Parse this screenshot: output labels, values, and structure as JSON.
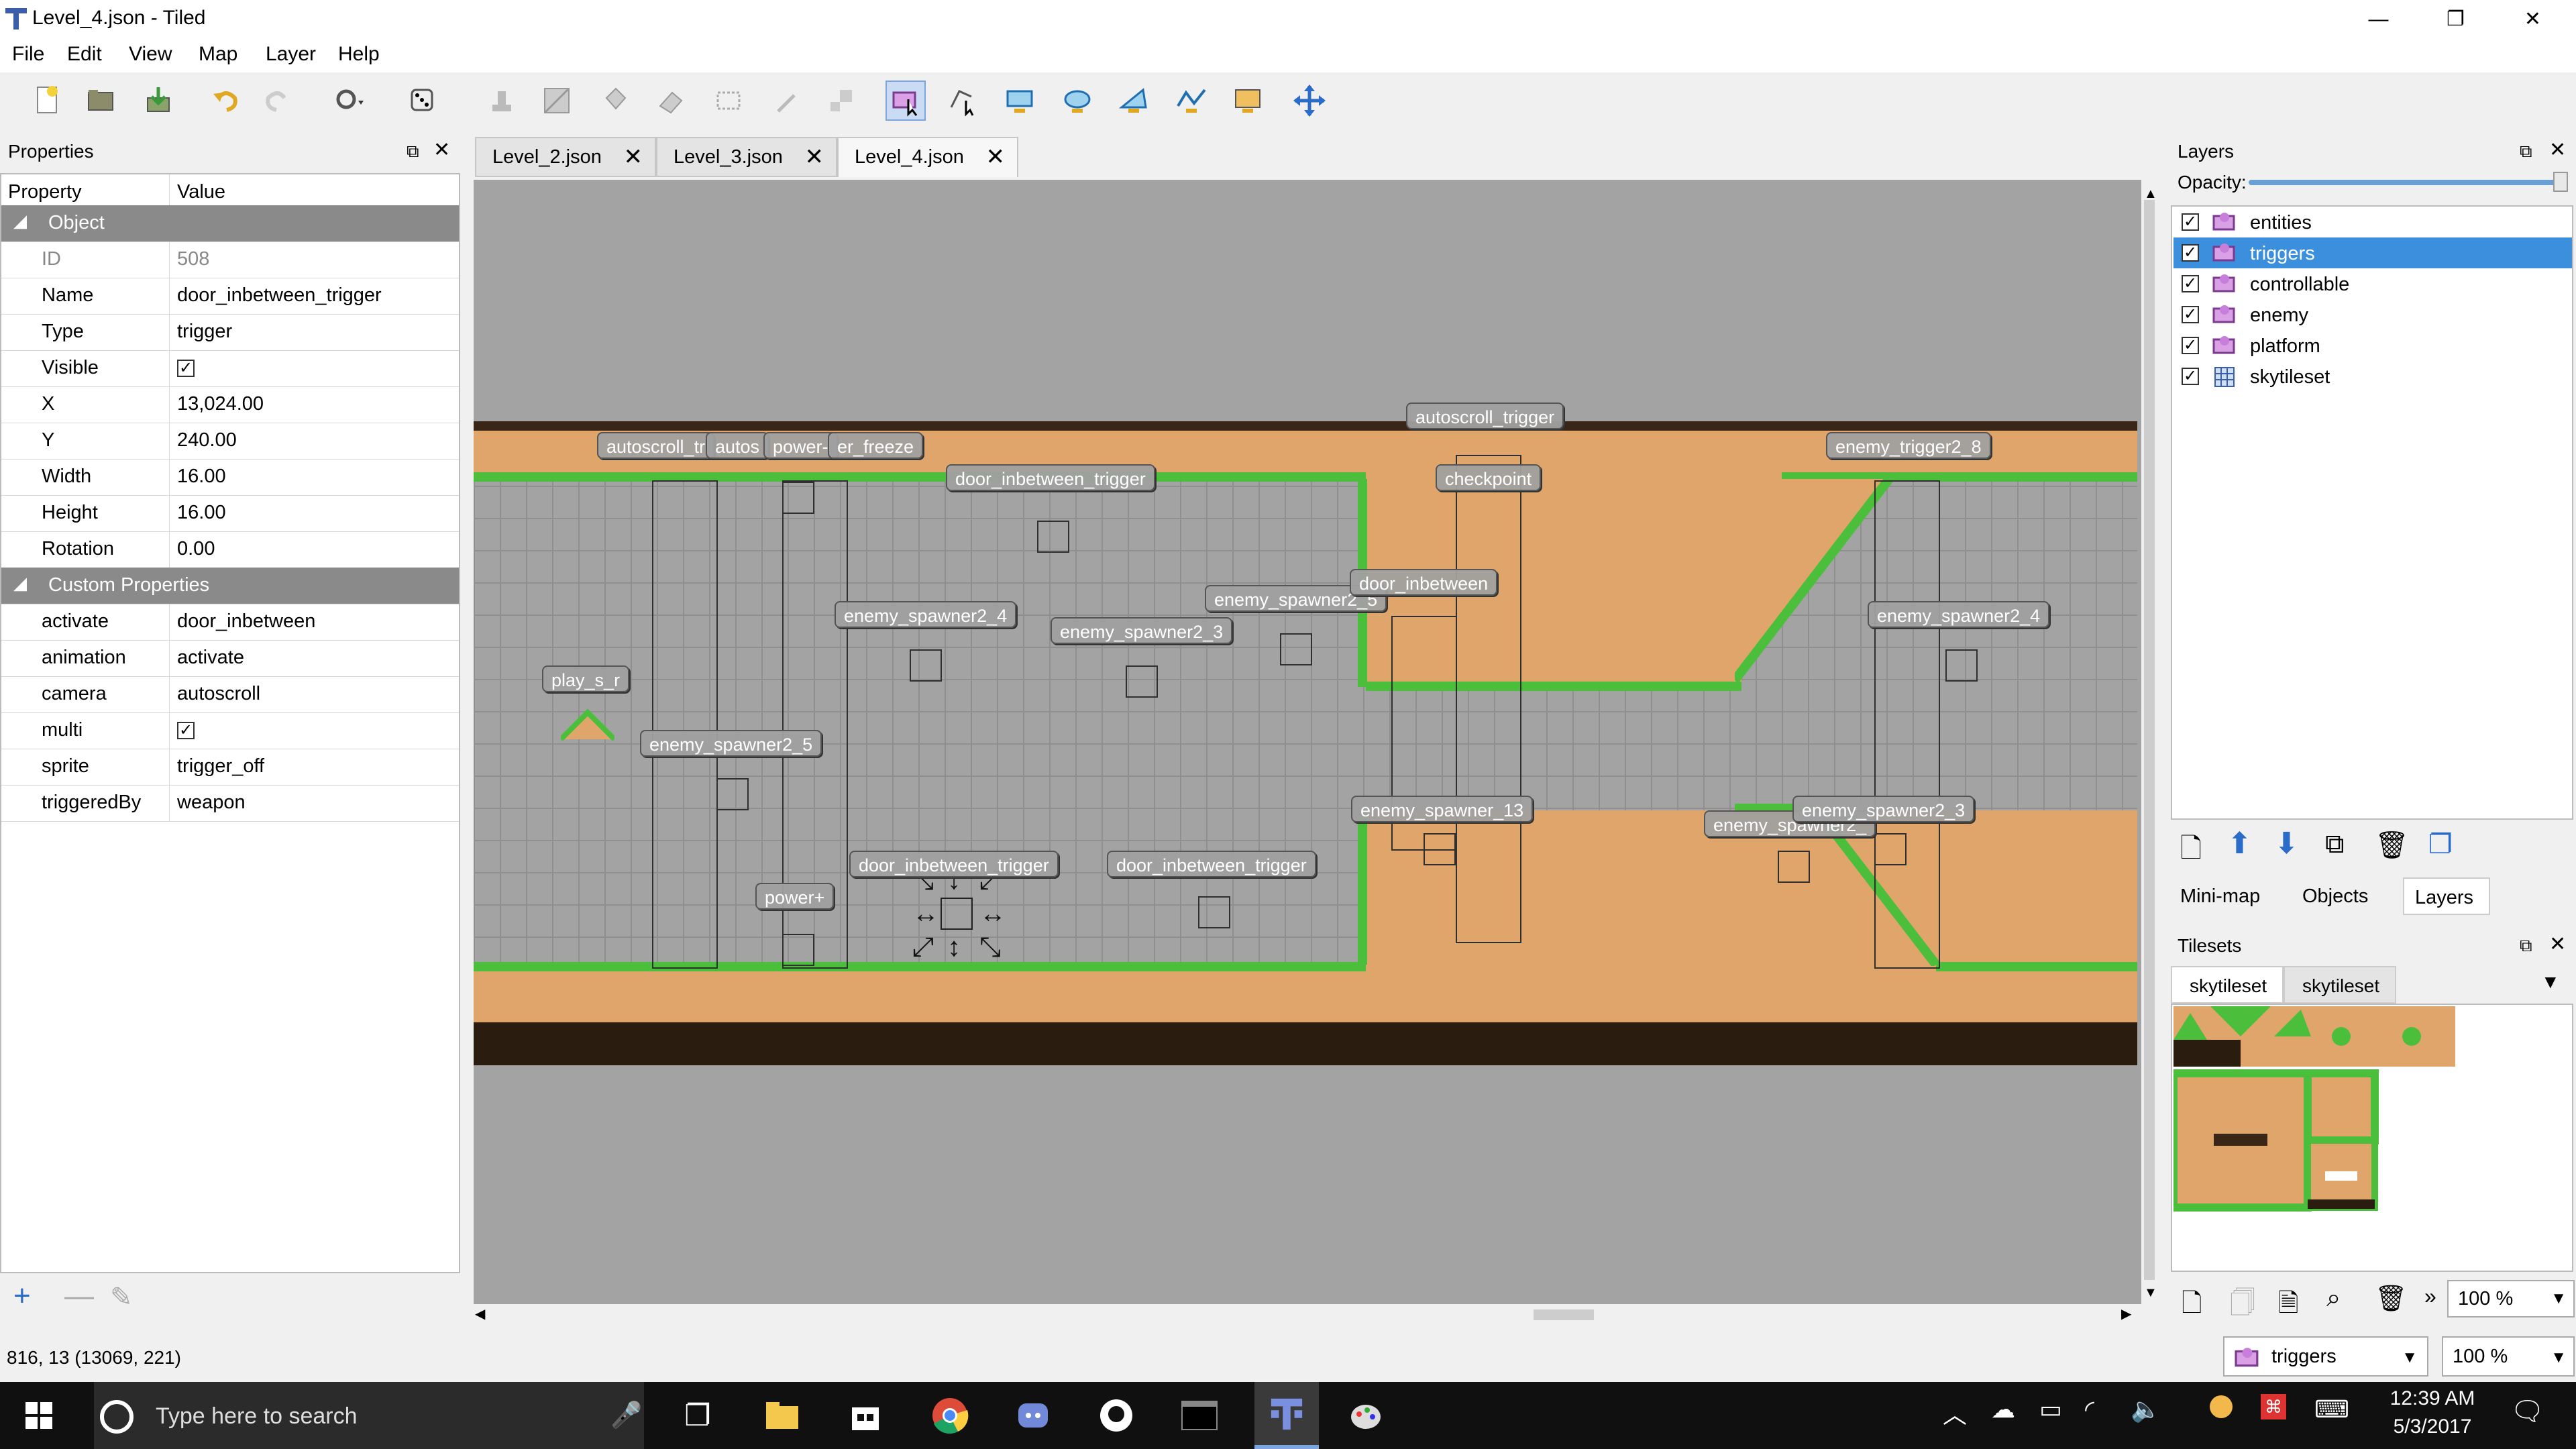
{
  "window": {
    "title": "Level_4.json - Tiled",
    "minimize": "—",
    "restore": "❐",
    "close": "✕"
  },
  "menu": [
    "File",
    "Edit",
    "View",
    "Map",
    "Layer",
    "Help"
  ],
  "properties": {
    "panel_title": "Properties",
    "col_property": "Property",
    "col_value": "Value",
    "object_group": "Object",
    "id_label": "ID",
    "id_value": "508",
    "name_label": "Name",
    "name_value": "door_inbetween_trigger",
    "type_label": "Type",
    "type_value": "trigger",
    "visible_label": "Visible",
    "visible_value": "✓",
    "x_label": "X",
    "x_value": "13,024.00",
    "y_label": "Y",
    "y_value": "240.00",
    "width_label": "Width",
    "width_value": "16.00",
    "height_label": "Height",
    "height_value": "16.00",
    "rotation_label": "Rotation",
    "rotation_value": "0.00",
    "custom_group": "Custom Properties",
    "activate_label": "activate",
    "activate_value": "door_inbetween",
    "animation_label": "animation",
    "animation_value": "activate",
    "camera_label": "camera",
    "camera_value": "autoscroll",
    "multi_label": "multi",
    "multi_value": "✓",
    "sprite_label": "sprite",
    "sprite_value": "trigger_off",
    "triggeredBy_label": "triggeredBy",
    "triggeredBy_value": "weapon"
  },
  "tabs": [
    {
      "label": "Level_2.json"
    },
    {
      "label": "Level_3.json"
    },
    {
      "label": "Level_4.json"
    }
  ],
  "map_labels": {
    "autoscroll_tr": "autoscroll_tr",
    "autos": "autos",
    "power_minus": "power-",
    "er_freeze": "er_freeze",
    "door_inbetween_trigger_1": "door_inbetween_trigger",
    "autoscroll_trigger": "autoscroll_trigger",
    "checkpoint": "checkpoint",
    "enemy_trigger2_8": "enemy_trigger2_8",
    "enemy_spawner2_4a": "enemy_spawner2_4",
    "enemy_spawner2_3a": "enemy_spawner2_3",
    "enemy_spawner2_5b": "enemy_spawner2_5",
    "door_inbetween": "door_inbetween",
    "enemy_spawner2_4b": "enemy_spawner2_4",
    "play_s_r": "play_s_r",
    "enemy_spawner2_5a": "enemy_spawner2_5",
    "enemy_spawner_13": "enemy_spawner_13",
    "enemy_spawner2_x": "enemy_spawner2_",
    "enemy_spawner2_3b": "enemy_spawner2_3",
    "door_inbetween_trigger_2": "door_inbetween_trigger",
    "door_inbetween_trigger_3": "door_inbetween_trigger",
    "power_plus": "power+"
  },
  "layers": {
    "panel_title": "Layers",
    "opacity_label": "Opacity:",
    "opacity": 1.0,
    "items": [
      {
        "name": "entities",
        "checked": "✓"
      },
      {
        "name": "triggers",
        "checked": "✓"
      },
      {
        "name": "controllable",
        "checked": "✓"
      },
      {
        "name": "enemy",
        "checked": "✓"
      },
      {
        "name": "platform",
        "checked": "✓"
      },
      {
        "name": "skytileset",
        "checked": "✓"
      }
    ],
    "subtabs": [
      "Mini-map",
      "Objects",
      "Layers"
    ]
  },
  "tilesets": {
    "panel_title": "Tilesets",
    "tabs": [
      "skytileset",
      "skytileset"
    ],
    "zoom": "100 %",
    "more": "»"
  },
  "status": {
    "coords": "816, 13 (13069, 221)",
    "layer_combo": "triggers",
    "zoom": "100 %"
  },
  "taskbar": {
    "search_placeholder": "Type here to search",
    "time": "12:39 AM",
    "date": "5/3/2017"
  },
  "colors": {
    "accent": "#3b8fdc",
    "dirt": "#e0a56a",
    "grass": "#4bbf3c",
    "canvas": "#a3a3a3"
  }
}
